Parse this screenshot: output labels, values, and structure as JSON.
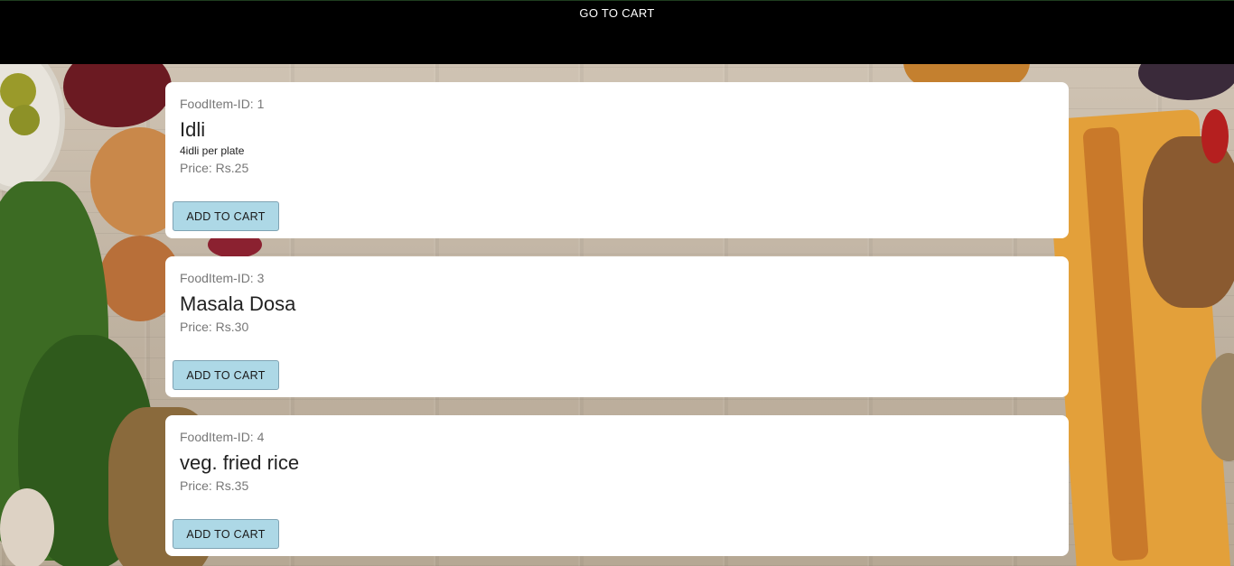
{
  "header": {
    "go_to_cart_label": "GO TO CART"
  },
  "items": [
    {
      "id_label": "FoodItem-ID: 1",
      "name": "Idli",
      "description": "4idli per plate",
      "price_label": "Price: Rs.25",
      "button_label": "ADD TO CART"
    },
    {
      "id_label": "FoodItem-ID: 3",
      "name": "Masala Dosa",
      "price_label": "Price: Rs.30",
      "button_label": "ADD TO CART"
    },
    {
      "id_label": "FoodItem-ID: 4",
      "name": "veg. fried rice",
      "price_label": "Price: Rs.35",
      "button_label": "ADD TO CART"
    }
  ],
  "colors": {
    "topbar": "#000000",
    "card": "#ffffff",
    "button": "#add8e6",
    "muted_text": "#777777"
  }
}
